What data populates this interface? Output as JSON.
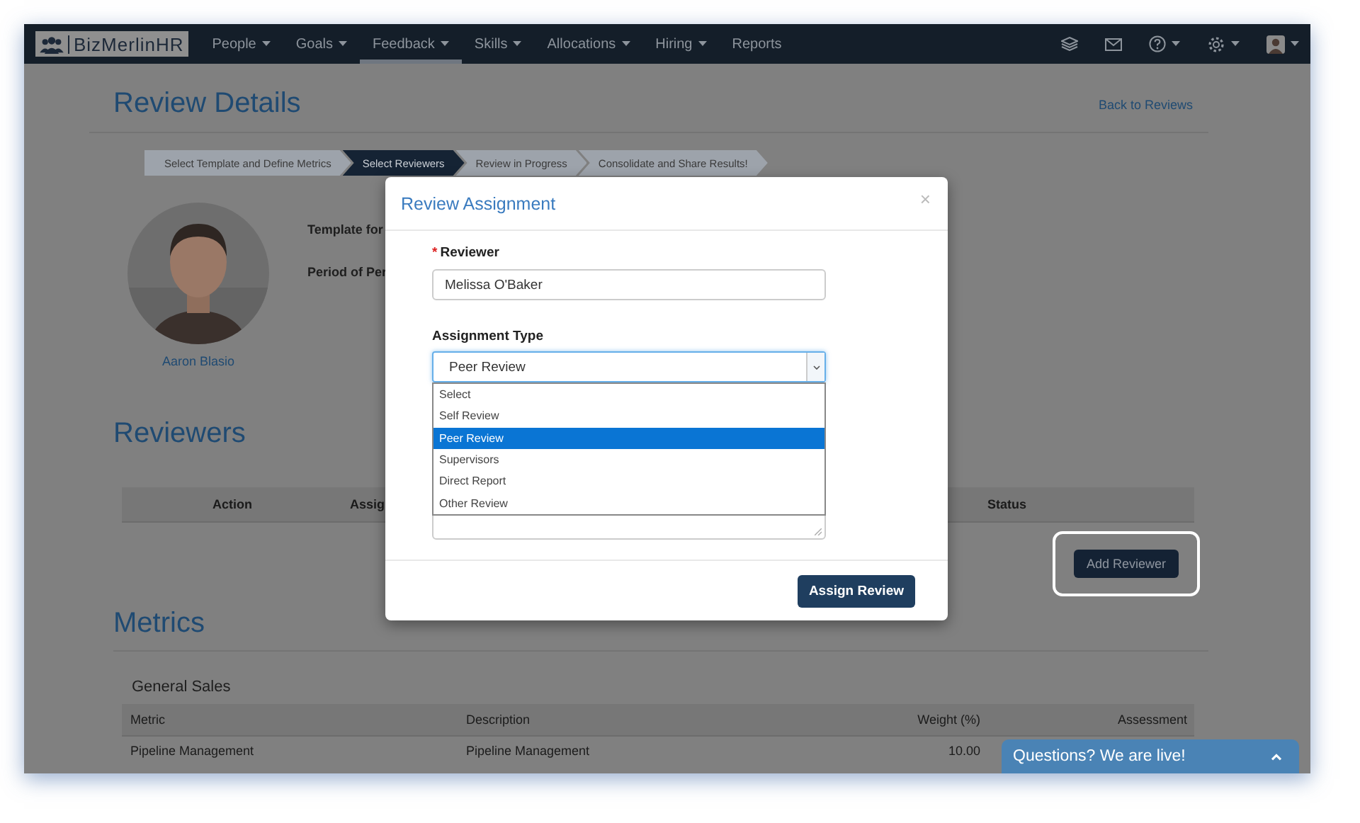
{
  "nav": {
    "logo": "BizMerlinHR",
    "items": [
      {
        "label": "People",
        "dropdown": true,
        "selected": false
      },
      {
        "label": "Goals",
        "dropdown": true,
        "selected": false
      },
      {
        "label": "Feedback",
        "dropdown": true,
        "selected": true
      },
      {
        "label": "Skills",
        "dropdown": true,
        "selected": false
      },
      {
        "label": "Allocations",
        "dropdown": true,
        "selected": false
      },
      {
        "label": "Hiring",
        "dropdown": true,
        "selected": false
      },
      {
        "label": "Reports",
        "dropdown": false,
        "selected": false
      }
    ]
  },
  "page": {
    "title": "Review Details",
    "back_link": "Back to Reviews",
    "steps": [
      {
        "label": "Select Template and Define Metrics",
        "selected": false
      },
      {
        "label": "Select Reviewers",
        "selected": true
      },
      {
        "label": "Review in Progress",
        "selected": false
      },
      {
        "label": "Consolidate and Share Results!",
        "selected": false
      }
    ],
    "employee": {
      "name": "Aaron Blasio"
    },
    "fields": [
      "Template for",
      "Period of Per"
    ],
    "reviewers": {
      "title": "Reviewers",
      "columns": [
        "Action",
        "Assig",
        "Status"
      ],
      "add_button": "Add Reviewer"
    },
    "metrics": {
      "title": "Metrics",
      "group": "General Sales",
      "columns": [
        "Metric",
        "Description",
        "Weight (%)",
        "Assessment"
      ],
      "rows": [
        [
          "Pipeline Management",
          "Pipeline Management",
          "10.00"
        ]
      ]
    }
  },
  "modal": {
    "title": "Review Assignment",
    "close": "×",
    "required_mark": "*",
    "reviewer_label": "Reviewer",
    "reviewer_value": "Melissa O'Baker",
    "type_label": "Assignment Type",
    "type_value": "Peer Review",
    "options": [
      {
        "label": "Select",
        "selected": false
      },
      {
        "label": "Self Review",
        "selected": false
      },
      {
        "label": "Peer Review",
        "selected": true
      },
      {
        "label": "Supervisors",
        "selected": false
      },
      {
        "label": "Direct Report",
        "selected": false
      },
      {
        "label": "Other Review",
        "selected": false
      }
    ],
    "submit": "Assign Review"
  },
  "chat": {
    "label": "Questions? We are live!"
  }
}
